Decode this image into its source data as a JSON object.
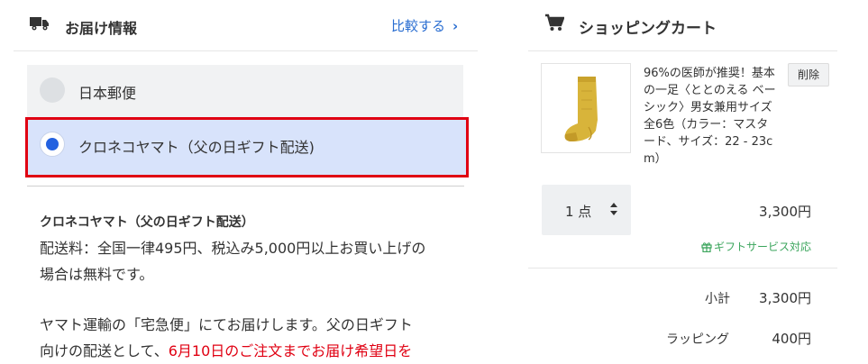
{
  "delivery": {
    "title": "お届け情報",
    "compare_label": "比較する",
    "compare_chevron": "›",
    "options": [
      {
        "label": "日本郵便",
        "selected": false
      },
      {
        "label": "クロネコヤマト（父の日ギフト配送)",
        "selected": true
      }
    ],
    "info": {
      "title": "クロネコヤマト（父の日ギフト配送）",
      "fee_line1": "配送料：全国一律495円、税込み5,000円以上お買い上げの",
      "fee_line2": "場合は無料です。",
      "note_line1": "ヤマト運輸の「宅急便」にてお届けします。父の日ギフト",
      "note_line2_black": "向けの配送として、",
      "note_line2_red": "6月10日のご注文までお届け希望日を"
    }
  },
  "cart": {
    "title": "ショッピングカート",
    "item": {
      "name_lines": [
        "96%の医師が推奨！基本",
        "の一足〈ととのえる ベー",
        "シック〉男女兼用サイズ",
        "全6色（カラー：マスタ",
        "ード、サイズ：22 - 23c",
        "m）"
      ],
      "delete_label": "削除",
      "quantity": "1 点",
      "price": "3,300円",
      "gift_label": "ギフトサービス対応"
    },
    "summary": {
      "subtotal_label": "小計",
      "subtotal_value": "3,300円",
      "wrapping_label": "ラッピング",
      "wrapping_value": "400円"
    }
  },
  "icons": {
    "truck": "truck-icon",
    "cart": "cart-icon",
    "chevron": "chevron-right-icon",
    "updown": "updown-arrows-icon",
    "gift": "gift-icon"
  },
  "colors": {
    "accent_blue": "#2a6ed1",
    "selected_bg": "#d8e3fb",
    "highlight_border": "#e00012",
    "gift_green": "#3ba55c"
  }
}
